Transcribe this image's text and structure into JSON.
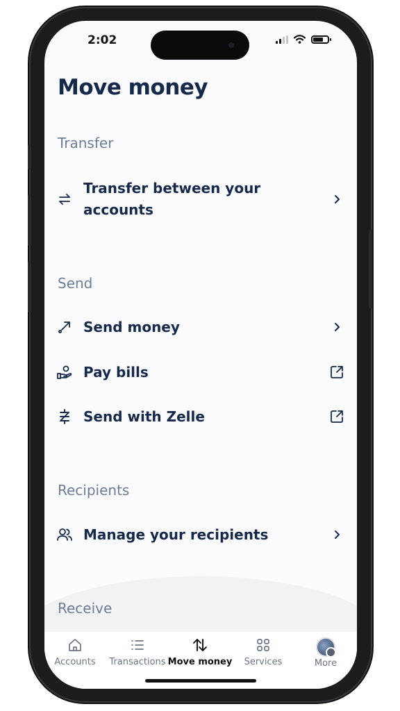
{
  "status_bar": {
    "time": "2:02"
  },
  "page_title": "Move money",
  "sections": {
    "transfer": {
      "heading": "Transfer",
      "items": [
        {
          "label_line1": "Transfer between your",
          "label_line2": "accounts",
          "icon": "transfer-arrows-icon",
          "trailing": "chevron-right-icon"
        }
      ]
    },
    "send": {
      "heading": "Send",
      "items": [
        {
          "label": "Send money",
          "icon": "send-arrow-icon",
          "trailing": "chevron-right-icon"
        },
        {
          "label": "Pay bills",
          "icon": "hand-coin-icon",
          "trailing": "external-link-icon"
        },
        {
          "label": "Send with Zelle",
          "icon": "zelle-icon",
          "trailing": "external-link-icon"
        }
      ]
    },
    "recipients": {
      "heading": "Recipients",
      "items": [
        {
          "label": "Manage your recipients",
          "icon": "people-icon",
          "trailing": "chevron-right-icon"
        }
      ]
    },
    "receive": {
      "heading": "Receive"
    }
  },
  "tab_bar": {
    "active": "Move money",
    "tabs": [
      {
        "label": "Accounts",
        "icon": "home-icon"
      },
      {
        "label": "Transactions",
        "icon": "list-icon"
      },
      {
        "label": "Move money",
        "icon": "up-down-arrows-icon"
      },
      {
        "label": "Services",
        "icon": "grid-icon"
      },
      {
        "label": "More",
        "icon": "avatar"
      }
    ]
  },
  "colors": {
    "primary_text": "#15294b",
    "section_text": "#6b7d95",
    "tab_text": "#6b7586"
  }
}
